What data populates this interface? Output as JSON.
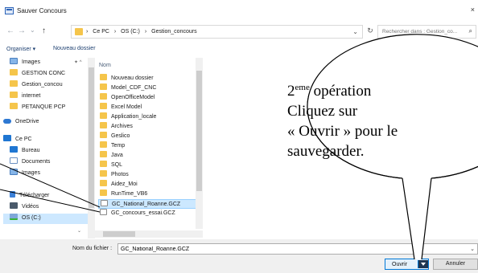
{
  "window": {
    "title": "Sauver Concours",
    "close": "×"
  },
  "address": {
    "crumbs": [
      "›",
      "Ce PC",
      "›",
      "OS (C:)",
      "›",
      "Gestion_concours"
    ],
    "search_placeholder": "Rechercher dans : Gestion_co..."
  },
  "toolbar": {
    "organize": "Organiser ▾",
    "new_folder": "Nouveau dossier"
  },
  "navpane": {
    "items": [
      {
        "label": "Images",
        "icon": "images-icon",
        "pinned": true
      },
      {
        "label": "GESTION CONC",
        "icon": "folder-icon"
      },
      {
        "label": "Gestion_concou",
        "icon": "folder-icon"
      },
      {
        "label": "internet",
        "icon": "folder-icon"
      },
      {
        "label": "PETANQUE PCP",
        "icon": "folder-icon"
      },
      {
        "label": "OneDrive",
        "icon": "onedrive-icon"
      },
      {
        "label": "Ce PC",
        "icon": "pc-icon"
      },
      {
        "label": "Bureau",
        "icon": "desktop-icon"
      },
      {
        "label": "Documents",
        "icon": "documents-icon"
      },
      {
        "label": "Images",
        "icon": "images-icon"
      },
      {
        "label": "Télécharger",
        "icon": "download-icon"
      },
      {
        "label": "Vidéos",
        "icon": "videos-icon"
      },
      {
        "label": "OS (C:)",
        "icon": "drive-icon"
      }
    ]
  },
  "files": {
    "column_header": "Nom",
    "items": [
      {
        "name": "Nouveau dossier",
        "type": "folder"
      },
      {
        "name": "Model_CDF_CNC",
        "type": "folder"
      },
      {
        "name": "OpenOfficeModel",
        "type": "folder"
      },
      {
        "name": "Excel Model",
        "type": "folder"
      },
      {
        "name": "Application_locale",
        "type": "folder"
      },
      {
        "name": "Archives",
        "type": "folder"
      },
      {
        "name": "Geslico",
        "type": "folder"
      },
      {
        "name": "Temp",
        "type": "folder"
      },
      {
        "name": "Java",
        "type": "folder"
      },
      {
        "name": "SQL",
        "type": "folder"
      },
      {
        "name": "Photos",
        "type": "folder"
      },
      {
        "name": "Aidez_Moi",
        "type": "folder"
      },
      {
        "name": "RunTime_VB6",
        "type": "folder"
      },
      {
        "name": "GC_National_Roanne.GCZ",
        "type": "file",
        "selected": true
      },
      {
        "name": "GC_concours_essai.GCZ",
        "type": "file"
      }
    ]
  },
  "bottom": {
    "filename_label": "Nom du fichier :",
    "filename_value": "GC_National_Roanne.GCZ",
    "open_label": "Ouvrir",
    "cancel_label": "Annuler"
  },
  "callout": {
    "sup": "eme",
    "line1_prefix": "2",
    "line1_rest": " opération",
    "line2": "Cliquez sur",
    "line3": "« Ouvrir » pour le",
    "line4": "sauvegarder."
  },
  "colors": {
    "accent": "#0078d7",
    "selection": "#cce8ff",
    "folder": "#f5c54b"
  }
}
